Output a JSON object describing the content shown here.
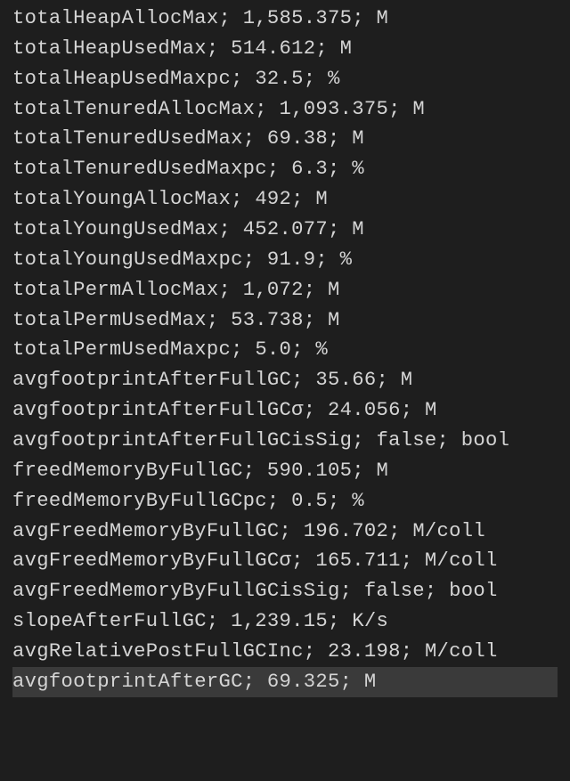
{
  "metrics": [
    {
      "name": "totalHeapAllocMax",
      "value": "1,585.375",
      "unit": "M",
      "highlighted": false
    },
    {
      "name": "totalHeapUsedMax",
      "value": "514.612",
      "unit": "M",
      "highlighted": false
    },
    {
      "name": "totalHeapUsedMaxpc",
      "value": "32.5",
      "unit": "%",
      "highlighted": false
    },
    {
      "name": "totalTenuredAllocMax",
      "value": "1,093.375",
      "unit": "M",
      "highlighted": false
    },
    {
      "name": "totalTenuredUsedMax",
      "value": "69.38",
      "unit": "M",
      "highlighted": false
    },
    {
      "name": "totalTenuredUsedMaxpc",
      "value": "6.3",
      "unit": "%",
      "highlighted": false
    },
    {
      "name": "totalYoungAllocMax",
      "value": "492",
      "unit": "M",
      "highlighted": false
    },
    {
      "name": "totalYoungUsedMax",
      "value": "452.077",
      "unit": "M",
      "highlighted": false
    },
    {
      "name": "totalYoungUsedMaxpc",
      "value": "91.9",
      "unit": "%",
      "highlighted": false
    },
    {
      "name": "totalPermAllocMax",
      "value": "1,072",
      "unit": "M",
      "highlighted": false
    },
    {
      "name": "totalPermUsedMax",
      "value": "53.738",
      "unit": "M",
      "highlighted": false
    },
    {
      "name": "totalPermUsedMaxpc",
      "value": "5.0",
      "unit": "%",
      "highlighted": false
    },
    {
      "name": "avgfootprintAfterFullGC",
      "value": "35.66",
      "unit": "M",
      "highlighted": false
    },
    {
      "name": "avgfootprintAfterFullGCσ",
      "value": "24.056",
      "unit": "M",
      "highlighted": false
    },
    {
      "name": "avgfootprintAfterFullGCisSig",
      "value": "false",
      "unit": "bool",
      "highlighted": false
    },
    {
      "name": "freedMemoryByFullGC",
      "value": "590.105",
      "unit": "M",
      "highlighted": false
    },
    {
      "name": "freedMemoryByFullGCpc",
      "value": "0.5",
      "unit": "%",
      "highlighted": false
    },
    {
      "name": "avgFreedMemoryByFullGC",
      "value": "196.702",
      "unit": "M/coll",
      "highlighted": false
    },
    {
      "name": "avgFreedMemoryByFullGCσ",
      "value": "165.711",
      "unit": "M/coll",
      "highlighted": false
    },
    {
      "name": "avgFreedMemoryByFullGCisSig",
      "value": "false",
      "unit": "bool",
      "highlighted": false
    },
    {
      "name": "slopeAfterFullGC",
      "value": "1,239.15",
      "unit": "K/s",
      "highlighted": false
    },
    {
      "name": "avgRelativePostFullGCInc",
      "value": "23.198",
      "unit": "M/coll",
      "highlighted": false
    },
    {
      "name": "avgfootprintAfterGC",
      "value": "69.325",
      "unit": "M",
      "highlighted": true
    }
  ]
}
